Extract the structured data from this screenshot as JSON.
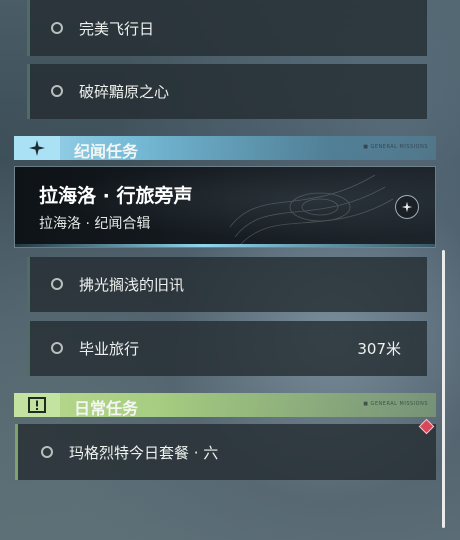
{
  "story_quests": [
    {
      "label": "完美飞行日"
    },
    {
      "label": "破碎黯原之心"
    }
  ],
  "legend_section": {
    "title": "纪闻任务",
    "tag": "■ GENERAL MISSIONS",
    "icon": "sparkle-star-icon",
    "color": "#9fd6ec"
  },
  "featured_quest": {
    "title": "拉海洛 · 行旅旁声",
    "subtitle": "拉海洛 · 纪闻合辑",
    "icon": "track-star-icon"
  },
  "legend_quests": [
    {
      "label": "拂光搁浅的旧讯",
      "distance": ""
    },
    {
      "label": "毕业旅行",
      "distance": "307米"
    }
  ],
  "daily_section": {
    "title": "日常任务",
    "tag": "■ GENERAL MISSIONS",
    "icon": "alert-icon",
    "color": "#b8d98e"
  },
  "daily_quests": [
    {
      "label": "玛格烈特今日套餐 · 六"
    }
  ]
}
